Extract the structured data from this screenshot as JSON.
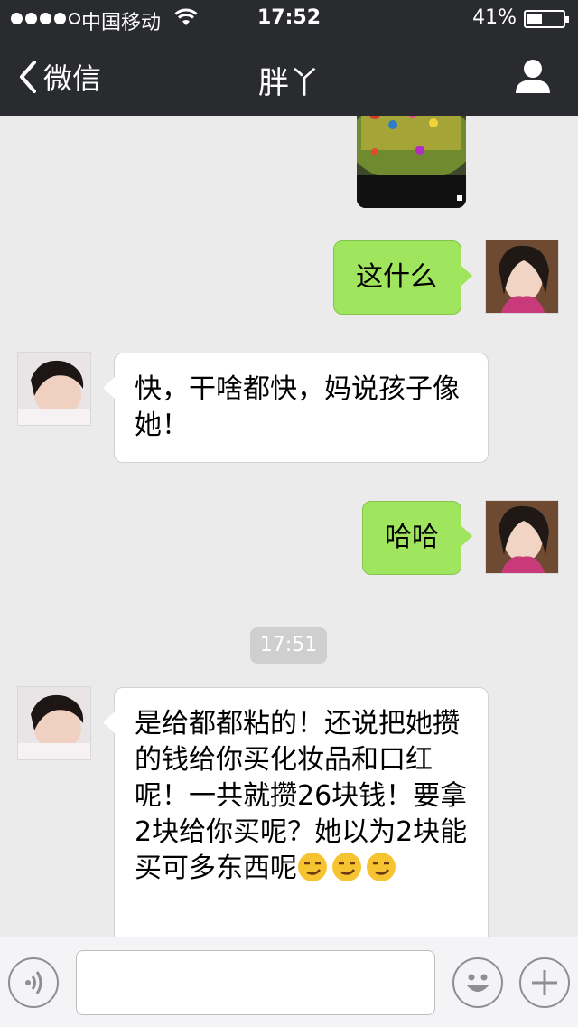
{
  "status_bar": {
    "carrier": "中国移动",
    "time": "17:52",
    "battery": "41%"
  },
  "nav": {
    "back_label": "微信",
    "title": "胖丫"
  },
  "messages": [
    {
      "sender": "me",
      "text": "这什么"
    },
    {
      "sender": "contact",
      "text": "快，干啥都快，妈说孩子像她！"
    },
    {
      "sender": "me",
      "text": "哈哈"
    },
    {
      "sender": "contact",
      "text": "是给都都粘的！还说把她攒的钱给你买化妆品和口红呢！一共就攒26块钱！要拿2块给你买呢？她以为2块能买可多东西呢"
    }
  ],
  "timestamp": "17:51",
  "colors": {
    "header_bg": "#2a2b2f",
    "sent_bubble": "#9fe55d",
    "received_bubble": "#ffffff",
    "chat_bg": "#ebebeb"
  },
  "icons": [
    "signal-icon",
    "wifi-icon",
    "battery-icon",
    "back-chevron-icon",
    "profile-icon",
    "voice-icon",
    "emoji-icon",
    "plus-icon",
    "smirk-emoji-icon"
  ]
}
